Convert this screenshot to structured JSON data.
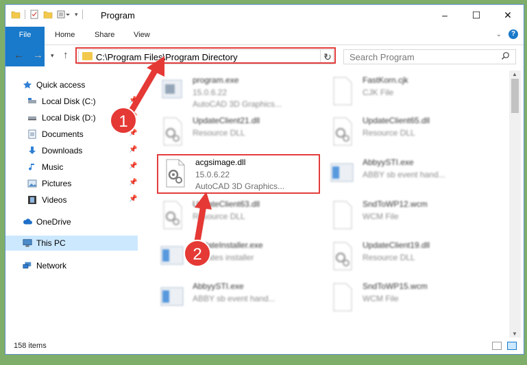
{
  "window": {
    "title": "Program",
    "controls": {
      "minimize": "–",
      "maximize": "☐",
      "close": "✕"
    }
  },
  "ribbon": {
    "tabs": [
      "File",
      "Home",
      "Share",
      "View"
    ],
    "help": "?"
  },
  "address": {
    "path": "C:\\Program Files\\Program Directory",
    "search_placeholder": "Search Program"
  },
  "nav": {
    "items": [
      {
        "label": "Quick access",
        "icon": "star-icon"
      },
      {
        "label": "Local Disk (C:)",
        "icon": "drive-icon",
        "pinned": true
      },
      {
        "label": "Local Disk (D:)",
        "icon": "drive-icon",
        "pinned": true
      },
      {
        "label": "Documents",
        "icon": "documents-icon",
        "pinned": true
      },
      {
        "label": "Downloads",
        "icon": "download-icon",
        "pinned": true
      },
      {
        "label": "Music",
        "icon": "music-icon",
        "pinned": true
      },
      {
        "label": "Pictures",
        "icon": "pictures-icon",
        "pinned": true
      },
      {
        "label": "Videos",
        "icon": "videos-icon",
        "pinned": true
      },
      {
        "label": "OneDrive",
        "icon": "cloud-icon"
      },
      {
        "label": "This PC",
        "icon": "computer-icon",
        "selected": true
      },
      {
        "label": "Network",
        "icon": "network-icon"
      }
    ]
  },
  "files": [
    {
      "name": "program.exe",
      "line1": "15.0.6.22",
      "line2": "AutoCAD 3D Graphics...",
      "kind": "exe"
    },
    {
      "name": "FastKorn.cjk",
      "line1": "CJK File",
      "line2": "",
      "kind": "doc"
    },
    {
      "name": "UpdateClient21.dll",
      "line1": "Resource DLL",
      "line2": "",
      "kind": "dll"
    },
    {
      "name": "UpdateClient65.dll",
      "line1": "Resource DLL",
      "line2": "",
      "kind": "dll"
    },
    {
      "name": "acgsimage.dll",
      "line1": "15.0.6.22",
      "line2": "AutoCAD 3D Graphics...",
      "kind": "dll"
    },
    {
      "name": "AbbyySTI.exe",
      "line1": "ABBY sb event hand...",
      "line2": "",
      "kind": "exe"
    },
    {
      "name": "UpdateClient63.dll",
      "line1": "Resource DLL",
      "line2": "",
      "kind": "dll"
    },
    {
      "name": "SndToWP12.wcm",
      "line1": "WCM File",
      "line2": "",
      "kind": "doc"
    },
    {
      "name": "UpdateInstaller.exe",
      "line1": "Updates installer",
      "line2": "",
      "kind": "exe"
    },
    {
      "name": "UpdateClient19.dll",
      "line1": "Resource DLL",
      "line2": "",
      "kind": "dll"
    },
    {
      "name": "AbbyySTI.exe",
      "line1": "ABBY sb event hand...",
      "line2": "",
      "kind": "exe"
    },
    {
      "name": "SndToWP15.wcm",
      "line1": "WCM File",
      "line2": "",
      "kind": "doc"
    }
  ],
  "status": {
    "item_count": "158 items"
  },
  "annotations": {
    "step1": "1",
    "step2": "2"
  },
  "colors": {
    "accent": "#1979ca",
    "highlight": "#e33c3c",
    "selection": "#cce8ff"
  }
}
